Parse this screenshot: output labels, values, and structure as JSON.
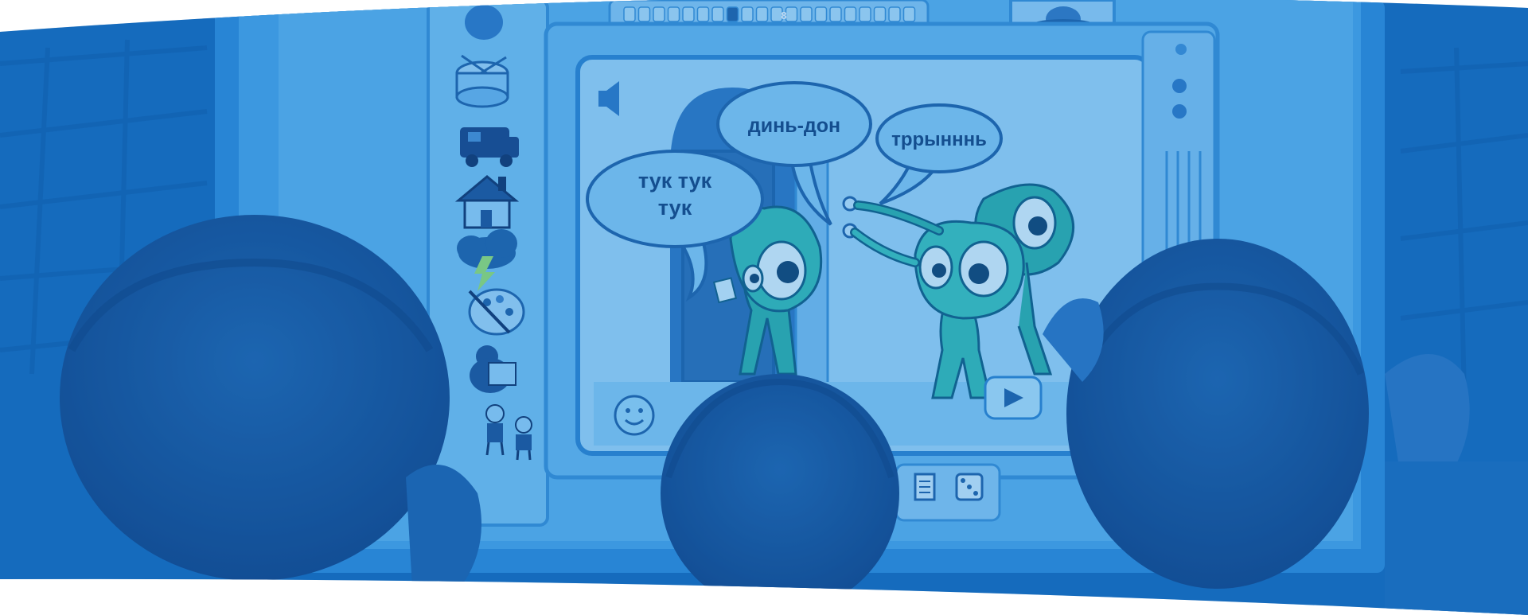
{
  "tint_color": "#1a78cc",
  "speech_bubbles": {
    "knock": [
      "тук тук",
      "тук"
    ],
    "ding_dong": "динь-дон",
    "ring": "тррынннь"
  },
  "page_indicator": {
    "current_page": "8",
    "total_pages": 20
  },
  "sidebar_icons": [
    "ufo-icon",
    "drum-icon",
    "van-icon",
    "house-icon",
    "thunderstorm-icon",
    "palette-icon",
    "bear-with-book-icon",
    "children-icon"
  ],
  "controls": [
    "sound-icon",
    "smiley-icon",
    "play-icon",
    "document-icon",
    "dice-icon"
  ]
}
